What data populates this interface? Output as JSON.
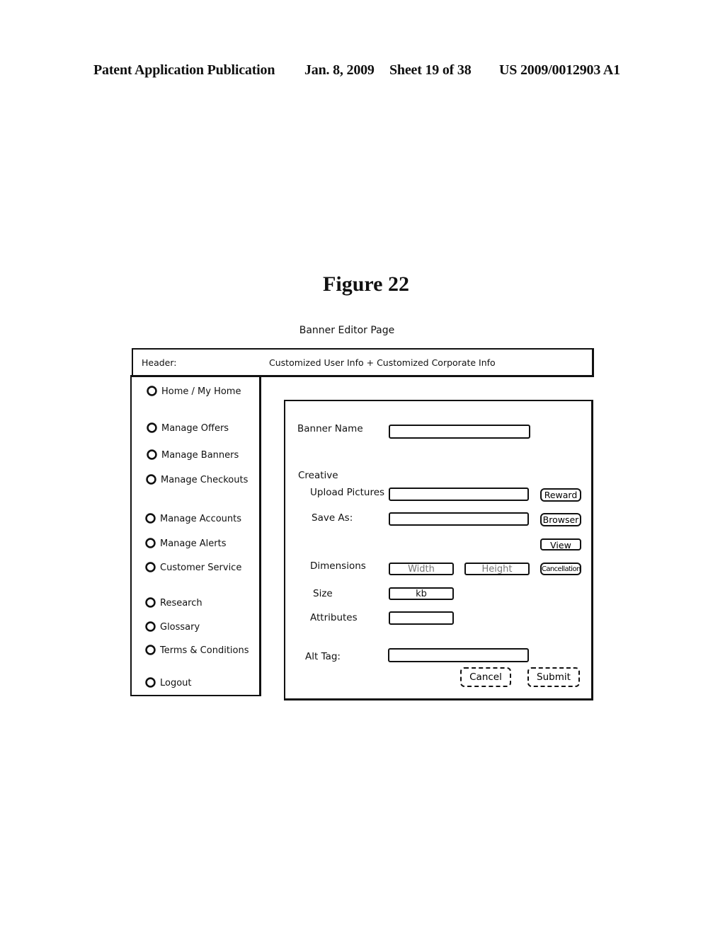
{
  "patent_header": {
    "publication_label": "Patent Application Publication",
    "date": "Jan. 8, 2009",
    "sheet": "Sheet 19 of 38",
    "number": "US 2009/0012903 A1"
  },
  "figure_title": "Figure 22",
  "page_title": "Banner Editor Page",
  "header": {
    "label": "Header:",
    "info": "Customized User Info + Customized Corporate Info"
  },
  "sidebar": {
    "items": [
      {
        "label": "Home / My Home",
        "icon": "circle-icon"
      },
      {
        "label": "Manage Offers",
        "icon": "circle-icon"
      },
      {
        "label": "Manage Banners",
        "icon": "circle-icon"
      },
      {
        "label": "Manage Checkouts",
        "icon": "circle-icon"
      },
      {
        "label": "Manage Accounts",
        "icon": "circle-icon"
      },
      {
        "label": "Manage Alerts",
        "icon": "circle-icon"
      },
      {
        "label": "Customer Service",
        "icon": "circle-icon"
      },
      {
        "label": "Research",
        "icon": "circle-icon"
      },
      {
        "label": "Glossary",
        "icon": "circle-icon"
      },
      {
        "label": "Terms & Conditions",
        "icon": "circle-icon"
      },
      {
        "label": "Logout",
        "icon": "circle-icon"
      }
    ]
  },
  "form": {
    "banner_name_label": "Banner Name",
    "banner_name_value": "",
    "creative_label": "Creative",
    "upload_pictures_label": "Upload Pictures",
    "upload_pictures_value": "",
    "save_as_label": "Save As:",
    "save_as_value": "",
    "dimensions_label": "Dimensions",
    "width_placeholder": "Width",
    "height_placeholder": "Height",
    "size_label": "Size",
    "size_unit": "kb",
    "attributes_label": "Attributes",
    "attributes_value": "",
    "alt_tag_label": "Alt Tag:",
    "alt_tag_value": ""
  },
  "buttons": {
    "reward": "Reward",
    "browser": "Browser",
    "view": "View",
    "cancellation": "Cancellation",
    "cancel": "Cancel",
    "submit": "Submit"
  }
}
